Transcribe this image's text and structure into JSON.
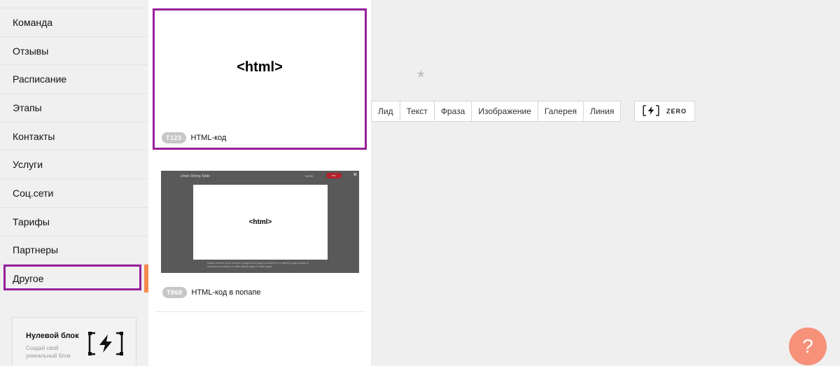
{
  "sidebar": {
    "categories": [
      {
        "label": "Команда"
      },
      {
        "label": "Отзывы"
      },
      {
        "label": "Расписание"
      },
      {
        "label": "Этапы"
      },
      {
        "label": "Контакты"
      },
      {
        "label": "Услуги"
      },
      {
        "label": "Соц.сети"
      },
      {
        "label": "Тарифы"
      },
      {
        "label": "Партнеры"
      },
      {
        "label": "Другое",
        "active": true
      }
    ],
    "zero_card": {
      "title": "Нулевой блок",
      "subtitle": "Создай свой уникальный блок",
      "icon": "zero-block-icon"
    }
  },
  "blocks": [
    {
      "code": "T123",
      "name": "HTML-код",
      "preview_text": "<html>"
    },
    {
      "code": "T868",
      "name": "HTML-код в попапе",
      "preview_text": "<html>",
      "preview_header": "Union Dining Table",
      "preview_price": "$1000",
      "preview_button": "BUY",
      "preview_body": "section in terms of the number of pages Each page is counted fee to different page number is expressed as printed, so differ display pages in blank pages."
    }
  ],
  "main": {
    "star": "★",
    "tabs": [
      {
        "label": "Лид"
      },
      {
        "label": "Текст"
      },
      {
        "label": "Фраза"
      },
      {
        "label": "Изображение"
      },
      {
        "label": "Галерея"
      },
      {
        "label": "Линия"
      }
    ],
    "zero_button": {
      "label": "ZERO",
      "icon": "zero-block-icon"
    },
    "help_button": {
      "label": "?",
      "icon": "help-icon"
    }
  },
  "colors": {
    "selection": "#96209a",
    "accent": "#f58a4f",
    "help": "#f7917a"
  }
}
